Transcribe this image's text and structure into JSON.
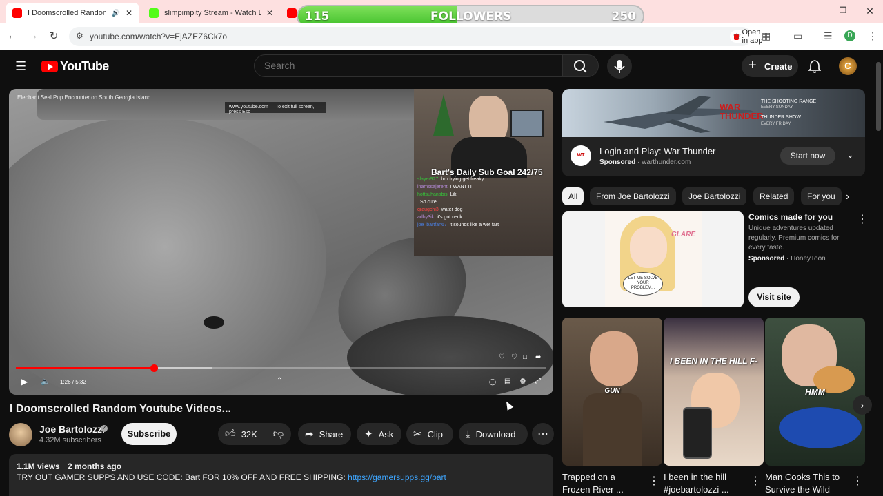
{
  "browser": {
    "tabs": [
      {
        "title": "I Doomscrolled Random Yo",
        "favicon_color": "#ff0000"
      },
      {
        "title": "slimpimpity Stream - Watch Liv",
        "favicon_color": "#53fc18"
      },
      {
        "title": "",
        "favicon_color": "#ff0000"
      }
    ],
    "url": "youtube.com/watch?v=EjAZEZ6Ck7o",
    "open_in_app": "Open in app",
    "profile_letter": "D"
  },
  "followers_overlay": {
    "current": "115",
    "label": "FOLLOWERS",
    "goal": "250",
    "progress_fraction": 0.46
  },
  "youtube_header": {
    "logo_text": "YouTube",
    "search_placeholder": "Search",
    "create_label": "Create",
    "avatar_letter": "C"
  },
  "player": {
    "caption": "Elephant Seal Pup Encounter on South Georgia Island",
    "fullscreen_hint": "www.youtube.com — To exit full screen, press  Esc",
    "sub_goal": "Bart's Daily Sub Goal 242/75",
    "chat": [
      {
        "user": "slayer927",
        "msg": "bro trying get freaky",
        "color": "#36c13a"
      },
      {
        "user": "inamssajerent",
        "msg": "I WANT IT",
        "color": "#b38ad6"
      },
      {
        "user": "hottsuhanabis",
        "msg": "Lik",
        "color": "#36c13a"
      },
      {
        "user": "",
        "msg": "So cute",
        "color": "#f1f1f1"
      },
      {
        "user": "qraugchi3",
        "msg": "water dog",
        "color": "#ff4444"
      },
      {
        "user": "adhy3ik",
        "msg": "it's got neck",
        "color": "#b38ad6"
      },
      {
        "user": "joe_bartfan67",
        "msg": "it sounds like a wet fart",
        "color": "#4a7fe0"
      }
    ],
    "time_display": "1:26 / 5:32",
    "played_fraction": 0.26,
    "buffered_fraction": 0.37
  },
  "video": {
    "title": "I Doomscrolled Random Youtube Videos...",
    "channel_name": "Joe Bartolozzi",
    "subscribers": "4.32M subscribers",
    "subscribe_label": "Subscribe",
    "likes": "32K",
    "share_label": "Share",
    "ask_label": "Ask",
    "clip_label": "Clip",
    "download_label": "Download",
    "views": "1.1M views",
    "age": "2 months ago",
    "description": "TRY OUT GAMER SUPPS AND USE CODE: Bart FOR 10% OFF AND FREE SHIPPING:",
    "description_link": "https://gamersupps.gg/bart"
  },
  "ad": {
    "banner_brand": "WAR THUNDER",
    "banner_line1": "THE SHOOTING RANGE",
    "banner_line2": "EVERY SUNDAY",
    "banner_line3": "THUNDER SHOW",
    "banner_line4": "EVERY FRIDAY",
    "title": "Login and Play: War Thunder",
    "sponsored": "Sponsored",
    "domain": "warthunder.com",
    "cta": "Start now"
  },
  "chips": [
    "All",
    "From Joe Bartolozzi",
    "Joe Bartolozzi",
    "Related",
    "For you"
  ],
  "comic_ad": {
    "title": "Comics made for you",
    "description": "Unique adventures updated regularly. Premium comics for every taste.",
    "sponsored": "Sponsored",
    "advertiser": "HoneyToon",
    "cta": "Visit site",
    "art_text1": "GLARE",
    "art_text2": "LET ME SOLVE YOUR PROBLEM..."
  },
  "shorts": [
    {
      "caption": "GUN",
      "title": "Trapped on a Frozen River ...",
      "bg": "#5a4a3c"
    },
    {
      "caption": "I BEEN IN THE HILL F-",
      "title": "I been in the hill #joebartolozzi ...",
      "bg": "#d9c7b8"
    },
    {
      "caption": "HMM",
      "title": "Man Cooks This to Survive the Wild",
      "bg": "#3a4a3a"
    }
  ]
}
